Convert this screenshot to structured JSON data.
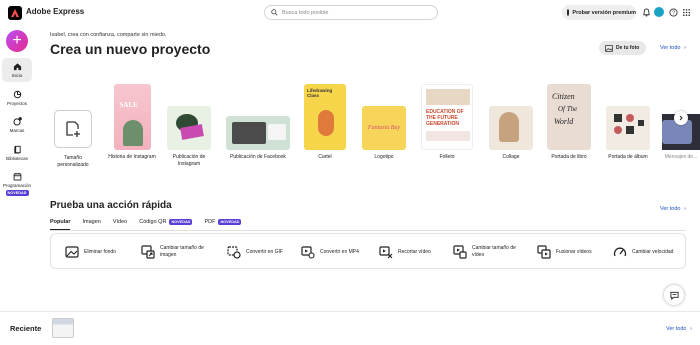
{
  "app": {
    "brand": "Adobe Express"
  },
  "search": {
    "placeholder": "Busca todo posible"
  },
  "header": {
    "premium_label": "Probar versión premium"
  },
  "sidebar": {
    "items": [
      {
        "label": "Inicio"
      },
      {
        "label": "Proyectos"
      },
      {
        "label": "Marcas"
      },
      {
        "label": "Bibliotecas"
      },
      {
        "label": "Programación",
        "badge": "NOVEDAD"
      }
    ]
  },
  "main": {
    "greeting": "Isabel, crea con confianza, comparte sin miedo.",
    "title": "Crea un nuevo proyecto",
    "photo_button": "De tu foto",
    "see_all": "Ver todo",
    "templates": [
      {
        "label": "Tamaño personalizado"
      },
      {
        "label": "Historia de Instagram"
      },
      {
        "label": "Publicación de Instagram"
      },
      {
        "label": "Publicación de Facebook"
      },
      {
        "label": "Cartel"
      },
      {
        "label": "Logotipo"
      },
      {
        "label": "Folleto"
      },
      {
        "label": "Collage"
      },
      {
        "label": "Portada de libro"
      },
      {
        "label": "Portada de álbum"
      },
      {
        "label": "Mensajes de..."
      }
    ],
    "thumb_text": {
      "sale": "SALE",
      "cartel": "Lifedrawing Class",
      "logo": "Fantasia Bay",
      "flyer_line1": "EDUCATION OF",
      "flyer_line2": "THE FUTURE",
      "flyer_line3": "GENERATION",
      "book1": "Citizen",
      "book2": "Of The",
      "book3": "World"
    }
  },
  "quick": {
    "title": "Prueba una acción rápida",
    "see_all": "Ver todo",
    "tabs": [
      {
        "label": "Popular"
      },
      {
        "label": "Imagen"
      },
      {
        "label": "Vídeo"
      },
      {
        "label": "Código QR",
        "badge": "NOVEDAD"
      },
      {
        "label": "PDF",
        "badge": "NOVEDAD"
      }
    ],
    "actions": [
      {
        "label": "Eliminar fondo"
      },
      {
        "label": "Cambiar tamaño de imagen"
      },
      {
        "label": "Convertir en GIF"
      },
      {
        "label": "Convertir en MP4"
      },
      {
        "label": "Recortar vídeo"
      },
      {
        "label": "Cambiar tamaño de vídeo"
      },
      {
        "label": "Fusionar vídeos"
      },
      {
        "label": "Cambiar velocidad"
      }
    ]
  },
  "recent": {
    "title": "Reciente",
    "see_all": "Ver todo"
  },
  "colors": {
    "accent": "#5a3ed6",
    "link": "#1a4ec0",
    "create": "#d23ad6"
  }
}
